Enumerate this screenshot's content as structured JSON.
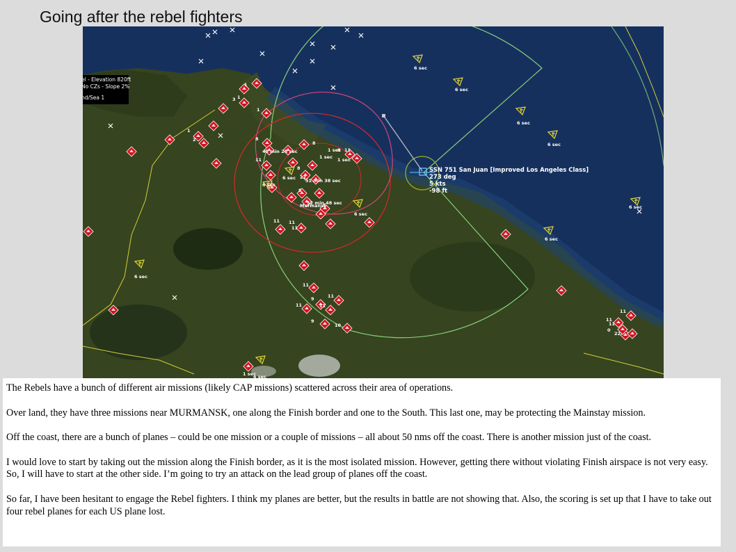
{
  "slide": {
    "title": "Going after the rebel fighters"
  },
  "hud": {
    "line1": "el - Elevation 820ft",
    "line2": "No CZs - Slope 2%",
    "line3": "nd/Sea 1"
  },
  "unit": {
    "name": "SSN 751 San Juan [Improved Los Angeles Class]",
    "heading": "273 deg",
    "speed": "5 kts",
    "depth": "-98 ft"
  },
  "map_labels": {
    "sec6": "6 sec",
    "sec1": "1 sec",
    "t1": "45 min 28 sec",
    "t2": "51 min 38 sec",
    "t3": "52 min 48 sec",
    "city": "Murmansk",
    "n1": "1",
    "n2": "2",
    "n3": "3",
    "n8": "8",
    "n9": "9",
    "n11": "11",
    "n22": "22",
    "n10": "10",
    "n0": "0"
  },
  "colors": {
    "sea": "#16305e",
    "land": "#35431f",
    "hostile": "#d0141e",
    "unknown": "#e0d838",
    "range_green": "#86d07a",
    "range_red": "#cc2a2a",
    "range_pink": "#d84478"
  },
  "notes": [
    "The Rebels have a bunch of different air missions (likely CAP missions) scattered across their area of operations.",
    "Over land, they have three missions near MURMANSK, one along the Finish border and one to the South.  This last one, may be protecting the Mainstay mission.",
    "Off the coast, there are a bunch of planes – could be one mission or a couple of missions – all about 50 nms off the coast.  There is another mission just of the coast.",
    "I would love to start by taking out the mission along the Finish border, as it is the most isolated mission.  However, getting there without violating Finish airspace is not very easy.  So, I will have to start at the other side.  I’m going to try an attack on the lead group of planes off the coast.",
    "So far, I have been hesitant to engage the Rebel fighters.  I think my planes are better, but the results in battle are not showing that.  Also, the scoring is set up that I have to take out four rebel planes for each US plane lost."
  ]
}
